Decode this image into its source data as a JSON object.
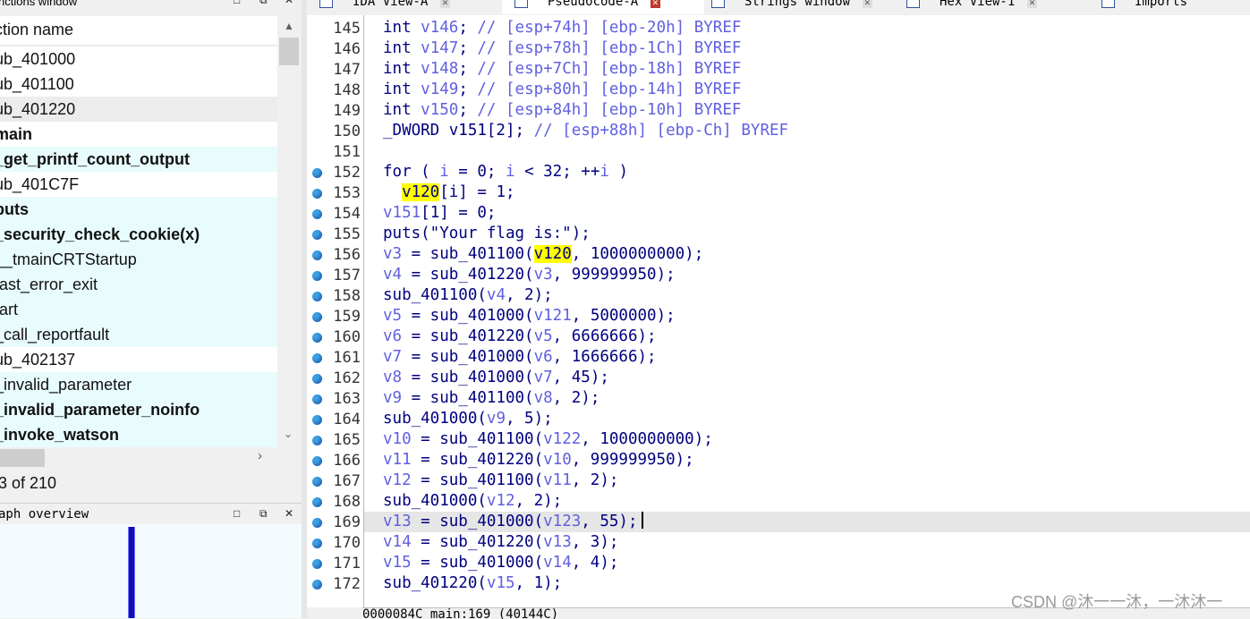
{
  "functions_window": {
    "title": "nctions window",
    "header": "ction name",
    "items": [
      {
        "name": "ub_401000",
        "bold": false,
        "lib": false,
        "selected": false
      },
      {
        "name": "ub_401100",
        "bold": false,
        "lib": false,
        "selected": false
      },
      {
        "name": "ub_401220",
        "bold": false,
        "lib": false,
        "selected": true
      },
      {
        "name": "main",
        "bold": true,
        "lib": false,
        "selected": false
      },
      {
        "name": "_get_printf_count_output",
        "bold": true,
        "lib": true,
        "selected": false
      },
      {
        "name": "ub_401C7F",
        "bold": false,
        "lib": false,
        "selected": false
      },
      {
        "name": "puts",
        "bold": true,
        "lib": true,
        "selected": false
      },
      {
        "name": "_security_check_cookie(x)",
        "bold": true,
        "lib": true,
        "selected": false
      },
      {
        "name": "__tmainCRTStartup",
        "bold": false,
        "lib": true,
        "selected": false
      },
      {
        "name": "fast_error_exit",
        "bold": false,
        "lib": true,
        "selected": false
      },
      {
        "name": "tart",
        "bold": false,
        "lib": true,
        "selected": false
      },
      {
        "name": "_call_reportfault",
        "bold": false,
        "lib": true,
        "selected": false
      },
      {
        "name": "ub_402137",
        "bold": false,
        "lib": false,
        "selected": false
      },
      {
        "name": "_invalid_parameter",
        "bold": false,
        "lib": true,
        "selected": false
      },
      {
        "name": "_invalid_parameter_noinfo",
        "bold": true,
        "lib": true,
        "selected": false
      },
      {
        "name": "_invoke_watson",
        "bold": true,
        "lib": true,
        "selected": false
      }
    ],
    "status": "3 of 210"
  },
  "graph_overview": {
    "title": "aph overview"
  },
  "window_controls": {
    "restore": "□",
    "float": "⧉",
    "close": "✕"
  },
  "tabs": [
    {
      "label": "IDA View-A",
      "active": false
    },
    {
      "label": "Pseudocode-A",
      "active": true
    },
    {
      "label": "Strings window",
      "active": false
    },
    {
      "label": "Hex View-1",
      "active": false
    },
    {
      "label": "Imports",
      "active": false
    }
  ],
  "code_lines": [
    {
      "num": "145",
      "dot": false,
      "html": "int <span class='v'>v146</span>; <span class='c'>// [esp+74h] [ebp-20h] BYREF</span>"
    },
    {
      "num": "146",
      "dot": false,
      "html": "int <span class='v'>v147</span>; <span class='c'>// [esp+78h] [ebp-1Ch] BYREF</span>"
    },
    {
      "num": "147",
      "dot": false,
      "html": "int <span class='v'>v148</span>; <span class='c'>// [esp+7Ch] [ebp-18h] BYREF</span>"
    },
    {
      "num": "148",
      "dot": false,
      "html": "int <span class='v'>v149</span>; <span class='c'>// [esp+80h] [ebp-14h] BYREF</span>"
    },
    {
      "num": "149",
      "dot": false,
      "html": "int <span class='v'>v150</span>; <span class='c'>// [esp+84h] [ebp-10h] BYREF</span>"
    },
    {
      "num": "150",
      "dot": false,
      "html": "_DWORD v151[2]; <span class='c'>// [esp+88h] [ebp-Ch] BYREF</span>"
    },
    {
      "num": "151",
      "dot": false,
      "html": ""
    },
    {
      "num": "152",
      "dot": true,
      "html": "for ( <span class='v'>i</span> = 0; <span class='v'>i</span> &lt; 32; ++<span class='v'>i</span> )"
    },
    {
      "num": "153",
      "dot": true,
      "html": "  <span class='hl'>v120</span>[i] = 1;"
    },
    {
      "num": "154",
      "dot": true,
      "html": "<span class='v'>v151</span>[1] = 0;"
    },
    {
      "num": "155",
      "dot": true,
      "html": "puts(\"Your flag is:\");"
    },
    {
      "num": "156",
      "dot": true,
      "html": "<span class='v'>v3</span> = sub_401100(<span class='hl'>v120</span>, 1000000000);"
    },
    {
      "num": "157",
      "dot": true,
      "html": "<span class='v'>v4</span> = sub_401220(<span class='v'>v3</span>, 999999950);"
    },
    {
      "num": "158",
      "dot": true,
      "html": "sub_401100(<span class='v'>v4</span>, 2);"
    },
    {
      "num": "159",
      "dot": true,
      "html": "<span class='v'>v5</span> = sub_401000(<span class='v'>v121</span>, 5000000);"
    },
    {
      "num": "160",
      "dot": true,
      "html": "<span class='v'>v6</span> = sub_401220(<span class='v'>v5</span>, 6666666);"
    },
    {
      "num": "161",
      "dot": true,
      "html": "<span class='v'>v7</span> = sub_401000(<span class='v'>v6</span>, 1666666);"
    },
    {
      "num": "162",
      "dot": true,
      "html": "<span class='v'>v8</span> = sub_401000(<span class='v'>v7</span>, 45);"
    },
    {
      "num": "163",
      "dot": true,
      "html": "<span class='v'>v9</span> = sub_401100(<span class='v'>v8</span>, 2);"
    },
    {
      "num": "164",
      "dot": true,
      "html": "sub_401000(<span class='v'>v9</span>, 5);"
    },
    {
      "num": "165",
      "dot": true,
      "html": "<span class='v'>v10</span> = sub_401100(<span class='v'>v122</span>, 1000000000);"
    },
    {
      "num": "166",
      "dot": true,
      "html": "<span class='v'>v11</span> = sub_401220(<span class='v'>v10</span>, 999999950);"
    },
    {
      "num": "167",
      "dot": true,
      "html": "<span class='v'>v12</span> = sub_401100(<span class='v'>v11</span>, 2);"
    },
    {
      "num": "168",
      "dot": true,
      "html": "sub_401000(<span class='v'>v12</span>, 2);"
    },
    {
      "num": "169",
      "dot": true,
      "cur": true,
      "html": "<span class='v'>v13</span> = sub_401000(<span class='v'>v123</span>, 55);<span class='caret'></span>"
    },
    {
      "num": "170",
      "dot": true,
      "html": "<span class='v'>v14</span> = sub_401220(<span class='v'>v13</span>, 3);"
    },
    {
      "num": "171",
      "dot": true,
      "html": "<span class='v'>v15</span> = sub_401000(<span class='v'>v14</span>, 4);"
    },
    {
      "num": "172",
      "dot": true,
      "html": "sub_401220(<span class='v'>v15</span>, 1);"
    }
  ],
  "status_line": "0000084C  main:169 (40144C)",
  "watermark": "CSDN @沐一一沐，一沐沐一"
}
